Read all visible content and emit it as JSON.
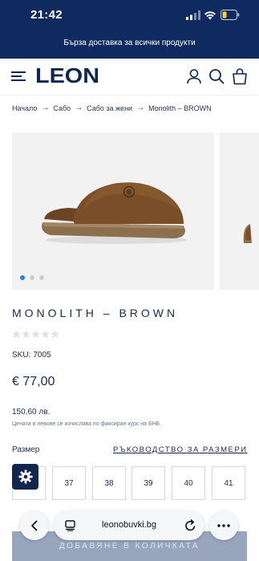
{
  "status_bar": {
    "time": "21:42"
  },
  "promo": {
    "text": "Бърза доставка за всички продукти"
  },
  "header": {
    "logo": "LEON"
  },
  "breadcrumb": {
    "items": [
      "Начало",
      "Сабо",
      "Сабо за жени",
      "Monolith – BROWN"
    ],
    "separator": "→"
  },
  "gallery": {
    "image_count": 3,
    "active_index": 0
  },
  "product": {
    "title": "MONOLITH – BROWN",
    "rating_stars": 5,
    "rating_value": 0,
    "sku_label": "SKU:",
    "sku_value": "7005",
    "price": "€ 77,00",
    "price_bgn": "150,60 лв.",
    "price_note": "Цената в левове се изчислява по фиксиран курс на БНБ."
  },
  "sizes": {
    "label": "Размер",
    "guide_link": "РЪКОВОДСТВО ЗА РАЗМЕРИ",
    "options": [
      "",
      "37",
      "38",
      "39",
      "40",
      "41"
    ]
  },
  "cart": {
    "add_label": "ДОБАВЯНЕ В КОЛИЧКАТА"
  },
  "browser": {
    "url": "leonobuvki.bg"
  },
  "colors": {
    "brand_navy": "#0e2a5e",
    "active_dot": "#2a7de1",
    "cart_button": "#98a5bd"
  }
}
